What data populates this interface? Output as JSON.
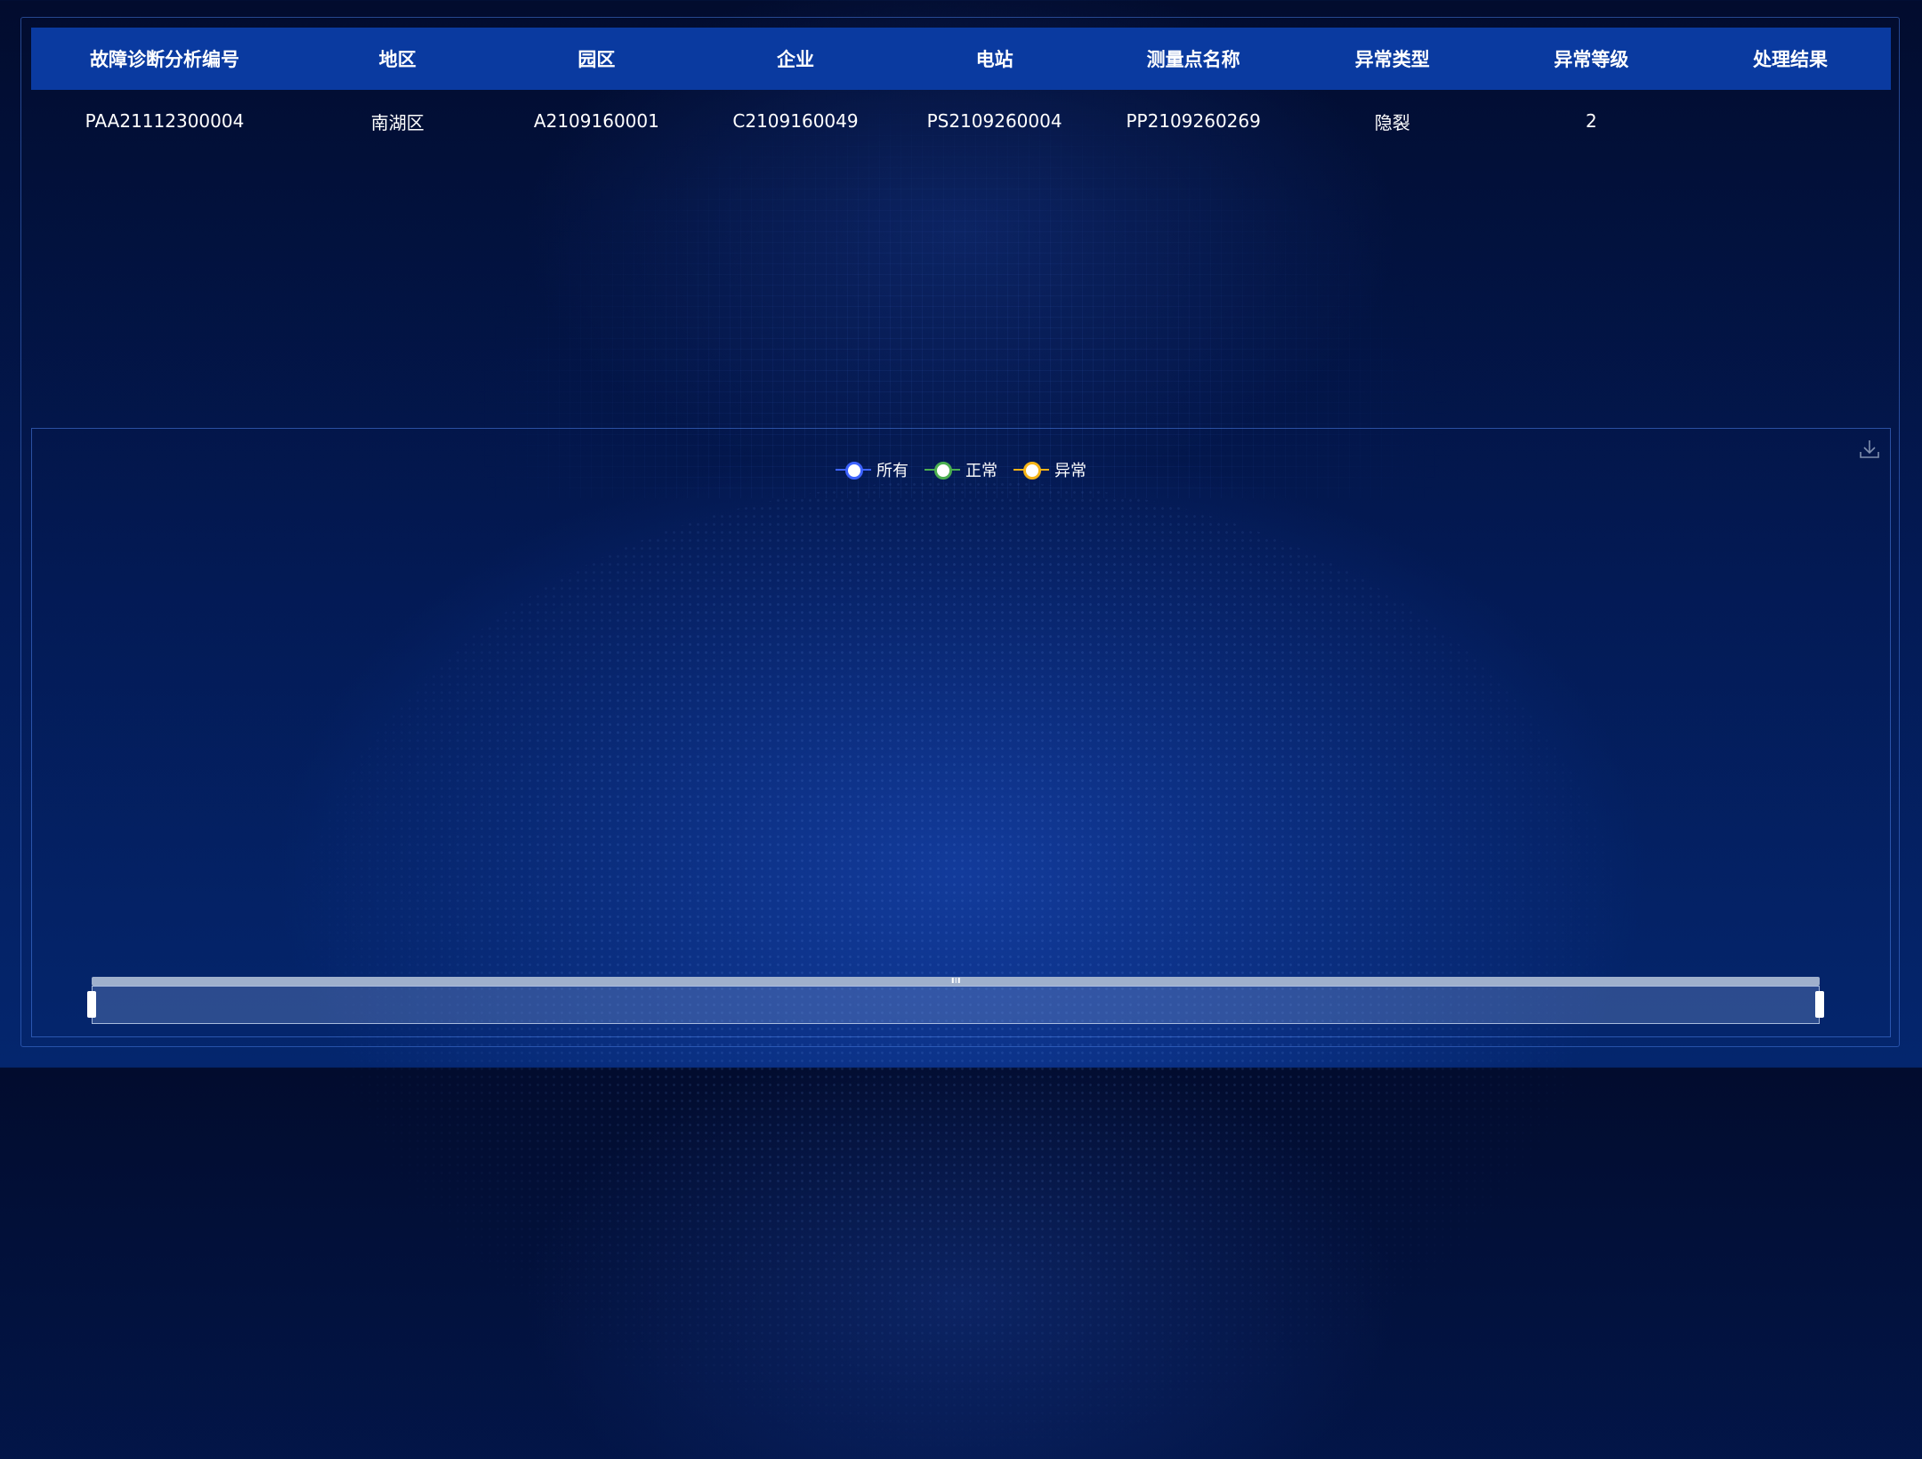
{
  "table": {
    "headers": [
      "故障诊断分析编号",
      "地区",
      "园区",
      "企业",
      "电站",
      "测量点名称",
      "异常类型",
      "异常等级",
      "处理结果"
    ],
    "rows": [
      [
        "PAA21112300004",
        "南湖区",
        "A2109160001",
        "C2109160049",
        "PS2109260004",
        "PP2109260269",
        "隐裂",
        "2",
        ""
      ]
    ]
  },
  "chart": {
    "download_icon": "download-icon",
    "legend": [
      {
        "label": "所有",
        "color": "#3d63ff"
      },
      {
        "label": "正常",
        "color": "#4caf50"
      },
      {
        "label": "异常",
        "color": "#f5b417"
      }
    ]
  },
  "chart_data": {
    "type": "line",
    "series": [
      {
        "name": "所有",
        "values": []
      },
      {
        "name": "正常",
        "values": []
      },
      {
        "name": "异常",
        "values": []
      }
    ],
    "legend_position": "top-center",
    "data_zoom": {
      "start": 0,
      "end": 100
    }
  }
}
